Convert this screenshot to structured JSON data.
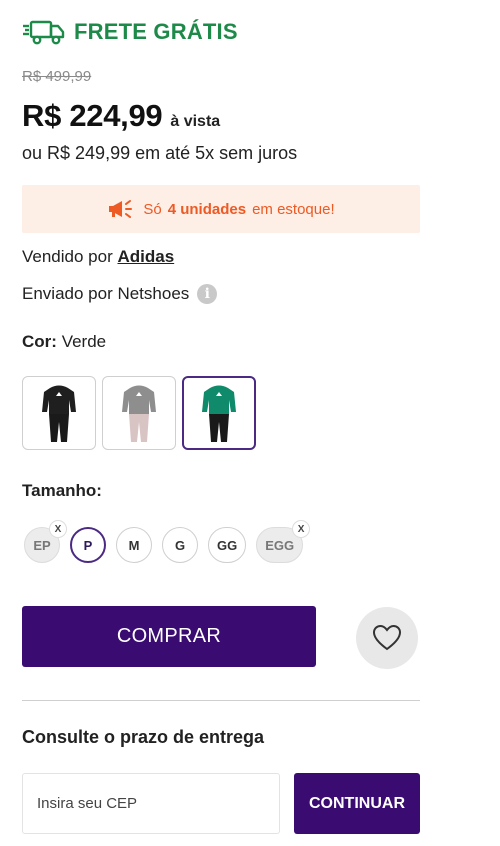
{
  "shipping": {
    "label": "FRETE GRÁTIS",
    "icon": "truck-icon",
    "color": "#1e8a4a"
  },
  "pricing": {
    "old_price": "R$ 499,99",
    "price": "R$ 224,99",
    "price_suffix": "à vista",
    "installments": "ou R$ 249,99 em até 5x sem juros"
  },
  "stock": {
    "icon": "megaphone-icon",
    "prefix": "Só",
    "highlight": "4 unidades",
    "suffix": "em estoque!",
    "color": "#ee5a24"
  },
  "seller": {
    "sold_label": "Vendido por",
    "sold_name": "Adidas",
    "shipped_label": "Enviado por Netshoes",
    "info_icon": "info-icon"
  },
  "color": {
    "label": "Cor:",
    "value": "Verde",
    "options": [
      {
        "name": "Preto",
        "top": "#1f1f1f",
        "pants": "#1a1a1a",
        "selected": false
      },
      {
        "name": "Cinza",
        "top": "#8e8e8e",
        "pants": "#d9c4c4",
        "selected": false
      },
      {
        "name": "Verde",
        "top": "#0f8a6a",
        "pants": "#1a1a1a",
        "selected": true
      }
    ]
  },
  "size": {
    "label": "Tamanho:",
    "options": [
      {
        "label": "EP",
        "available": false,
        "selected": false
      },
      {
        "label": "P",
        "available": true,
        "selected": true
      },
      {
        "label": "M",
        "available": true,
        "selected": false
      },
      {
        "label": "G",
        "available": true,
        "selected": false
      },
      {
        "label": "GG",
        "available": true,
        "selected": false
      },
      {
        "label": "EGG",
        "available": false,
        "selected": false
      }
    ],
    "unavailable_mark": "X"
  },
  "actions": {
    "buy_label": "COMPRAR",
    "favorite_icon": "heart-icon",
    "accent": "#3a0c72"
  },
  "delivery": {
    "title": "Consulte o prazo de entrega",
    "cep_placeholder": "Insira seu CEP",
    "cep_value": "",
    "continue_label": "CONTINUAR"
  }
}
